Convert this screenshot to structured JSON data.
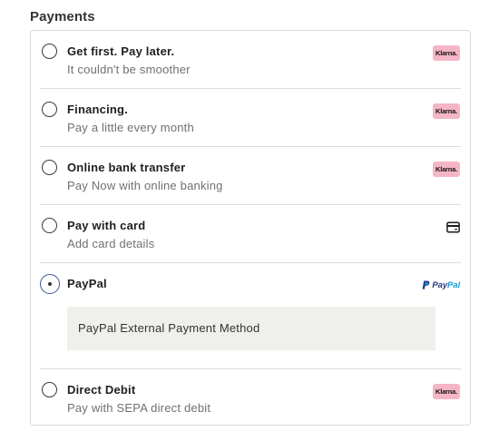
{
  "section": {
    "title": "Payments"
  },
  "options": [
    {
      "title": "Get first. Pay later.",
      "subtitle": "It couldn't be smoother",
      "icon": "klarna-logo",
      "badge": "Klarna.",
      "selected": false
    },
    {
      "title": "Financing.",
      "subtitle": "Pay a little every month",
      "icon": "klarna-logo",
      "badge": "Klarna.",
      "selected": false
    },
    {
      "title": "Online bank transfer",
      "subtitle": "Pay Now with online banking",
      "icon": "klarna-logo",
      "badge": "Klarna.",
      "selected": false
    },
    {
      "title": "Pay with card",
      "subtitle": "Add card details",
      "icon": "credit-card-icon",
      "selected": false
    },
    {
      "title": "PayPal",
      "icon": "paypal-logo",
      "logo_text_dark": "Pay",
      "logo_text_light": "Pal",
      "expanded_text": "PayPal External Payment Method",
      "selected": true
    },
    {
      "title": "Direct Debit",
      "subtitle": "Pay with SEPA direct debit",
      "icon": "klarna-logo",
      "badge": "Klarna.",
      "selected": false
    }
  ],
  "colors": {
    "klarna_pink": "#f4b6c7",
    "paypal_dark_blue": "#253b80",
    "paypal_light_blue": "#179bd7",
    "border": "#d9d9d9",
    "expanded_bg": "#efefec"
  }
}
